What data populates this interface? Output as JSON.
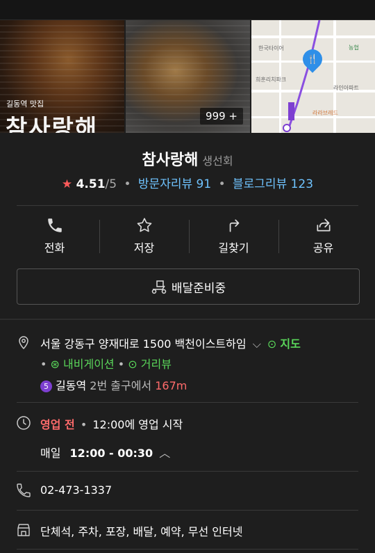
{
  "photos": {
    "photo1_tag": "길동역 맛집",
    "photo1_title": "참사랑해",
    "photo2_count": "999 +",
    "map_labels": {
      "l1": "한국타이어",
      "l2": "농협",
      "l3": "희훈리치파크",
      "l4": "라인아파트",
      "l5": "라라브레드"
    }
  },
  "place": {
    "name": "참사랑해",
    "category": "생선회",
    "rating": "4.51",
    "rating_max": "/5",
    "visitor_reviews": "방문자리뷰 91",
    "blog_reviews": "블로그리뷰 123"
  },
  "actions": {
    "call": "전화",
    "save": "저장",
    "directions": "길찾기",
    "share": "공유"
  },
  "delivery_label": "배달준비중",
  "address": {
    "text": "서울 강동구 양재대로 1500 백천이스트하임",
    "map_link": "지도",
    "navi_link": "내비게이션",
    "street_link": "거리뷰",
    "subway_line": "5",
    "station": "길동역",
    "exit_text": "2번 출구에서",
    "distance": "167m"
  },
  "hours": {
    "status": "영업 전",
    "notice": "12:00에 영업 시작",
    "days": "매일",
    "time": "12:00 - 00:30"
  },
  "phone": "02-473-1337",
  "amenities": "단체석, 주차, 포장, 배달, 예약, 무선 인터넷",
  "colors": {
    "background": "#1e1e1e",
    "link_blue": "#6fc3ff",
    "green": "#5ad75a",
    "red": "#ff6b6b",
    "star": "#ff5a5a",
    "subway_line5": "#7d3fd1"
  }
}
